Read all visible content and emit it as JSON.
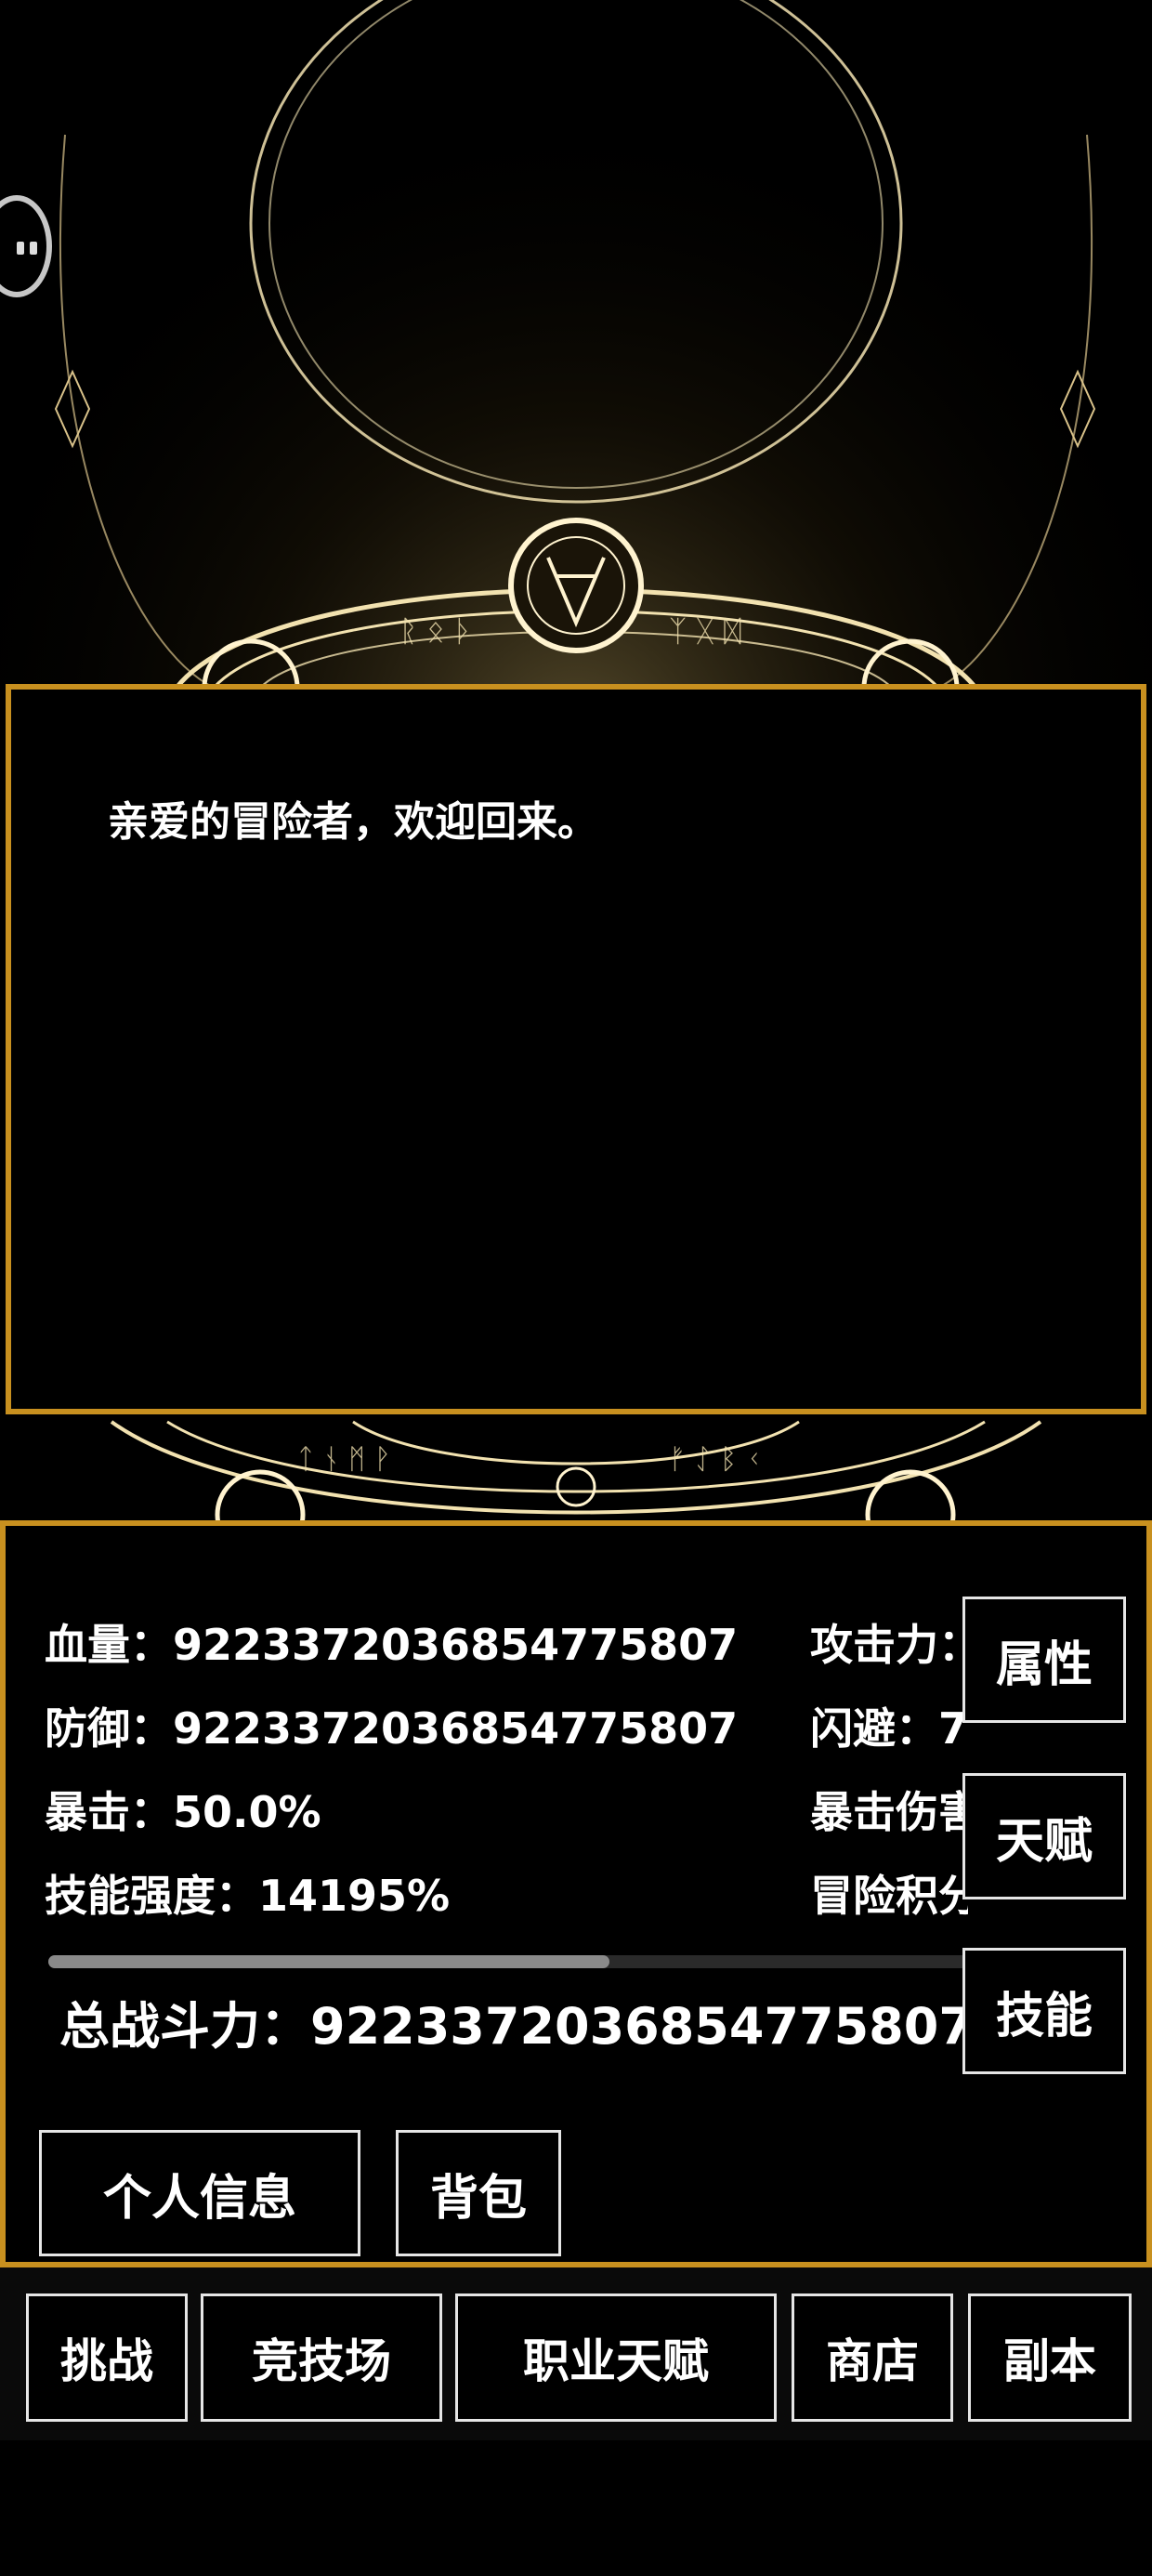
{
  "message": {
    "text": "亲爱的冒险者，欢迎回来。"
  },
  "stats": {
    "hp": "血量：9223372036854775807",
    "defense": "防御：9223372036854775807",
    "crit": "暴击：50.0%",
    "skill_power": "技能强度：14195%",
    "attack": "攻击力：",
    "dodge": "闪避：7",
    "crit_damage": "暴击伤害",
    "adventure_points": "冒险积分",
    "progress_fraction": 0.61,
    "total_power": "总战斗力：9223372036854775807"
  },
  "side_buttons": {
    "attributes": "属性",
    "talent": "天赋",
    "skills": "技能"
  },
  "panel_buttons": {
    "personal_info": "个人信息",
    "backpack": "背包"
  },
  "nav": {
    "challenge": "挑战",
    "arena": "竞技场",
    "class_talent": "职业天赋",
    "shop": "商店",
    "dungeon": "副本"
  },
  "colors": {
    "frame_gold": "#c8901f",
    "glow_gold": "#f2d27a",
    "background": "#000000"
  }
}
